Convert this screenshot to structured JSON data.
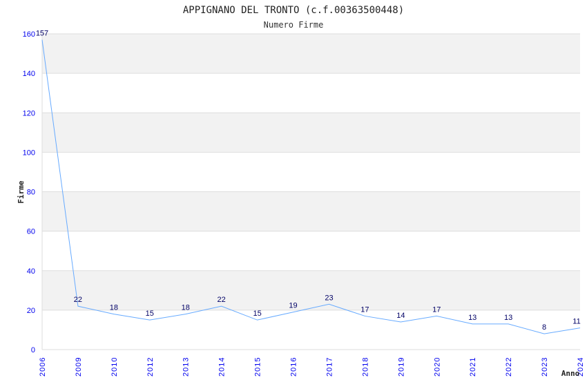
{
  "chart_data": {
    "type": "line",
    "title": "APPIGNANO DEL TRONTO (c.f.00363500448)",
    "subtitle": "Numero Firme",
    "xlabel": "Anno",
    "ylabel": "Firme",
    "categories": [
      "2006",
      "2009",
      "2010",
      "2012",
      "2013",
      "2014",
      "2015",
      "2016",
      "2017",
      "2018",
      "2019",
      "2020",
      "2021",
      "2022",
      "2023",
      "2024"
    ],
    "values": [
      157,
      22,
      18,
      15,
      18,
      22,
      15,
      19,
      23,
      17,
      14,
      17,
      13,
      13,
      8,
      11
    ],
    "ylim": [
      0,
      160
    ],
    "yticks": [
      0,
      20,
      40,
      60,
      80,
      100,
      120,
      140,
      160
    ],
    "grid": true,
    "colors": {
      "line": "#66aaff",
      "band": "#f2f2f2",
      "grid": "#dddddd",
      "tick": "#0000ee",
      "label": "#000066"
    }
  }
}
